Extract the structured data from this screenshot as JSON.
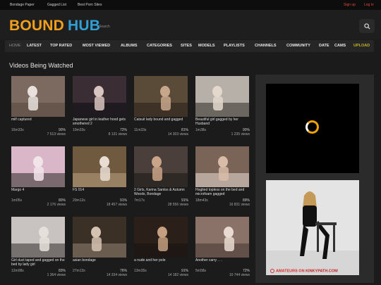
{
  "topbar": {
    "links": [
      "Bondage Paper",
      "Gagged List",
      "Best Porn Sites"
    ],
    "signup": "Sign up",
    "login": "Log in"
  },
  "logo": {
    "part1": "BOUND",
    "part2": "HUB"
  },
  "search": {
    "placeholder": "Search"
  },
  "nav": [
    "HOME",
    "LATEST",
    "TOP RATED",
    "MOST VIEWED",
    "ALBUMS",
    "CATEGORIES",
    "SITES",
    "MODELS",
    "PLAYLISTS",
    "CHANNELS",
    "COMMUNITY",
    "DATE",
    "CAMS",
    "UPLOAD"
  ],
  "section": {
    "title": "Videos Being Watched"
  },
  "videos": [
    {
      "title": "milf captured",
      "duration": "16m33s",
      "rating": "90%",
      "views": "7 513 views"
    },
    {
      "title": "Japanese girl in leather hood gets smothered 2",
      "duration": "10m33s",
      "rating": "72%",
      "views": "8 131 views"
    },
    {
      "title": "Catsuit lady bound and gagged",
      "duration": "11m33s",
      "rating": "81%",
      "views": "14 303 views"
    },
    {
      "title": "Beautiful girl gagged by her Husband",
      "duration": "1m38s",
      "rating": "90%",
      "views": "1 235 views"
    },
    {
      "title": "Margo 4",
      "duration": "1m05s",
      "rating": "80%",
      "views": "2 176 views"
    },
    {
      "title": "FS 014",
      "duration": "20m12s",
      "rating": "91%",
      "views": "18 457 views"
    },
    {
      "title": "2 Girls, Karina Santos & Autumn Woods, Bondage",
      "duration": "7m17s",
      "rating": "91%",
      "views": "28 556 views"
    },
    {
      "title": "Hogtied topless on the bed and microfoam gagged",
      "duration": "18m43s",
      "rating": "89%",
      "views": "16 831 views"
    },
    {
      "title": "Girl duct taped and gagged on the bed by lady girl",
      "duration": "12m08s",
      "rating": "83%",
      "views": "1 364 views"
    },
    {
      "title": "asian bondage",
      "duration": "27m13s",
      "rating": "76%",
      "views": "14 334 views"
    },
    {
      "title": "a nude and her pole",
      "duration": "13m35s",
      "rating": "91%",
      "views": "14 182 views"
    },
    {
      "title": "Another carry . . .",
      "duration": "5m58s",
      "rating": "72%",
      "views": "10 744 views"
    }
  ],
  "ad": {
    "prefix": "AMATEURS ON",
    "site": "KINKYPATH.COM"
  },
  "colors": {
    "accent_orange": "#f2a01b",
    "accent_blue": "#2f9fd6",
    "upload": "#c9b31f",
    "signup": "#e0463b"
  }
}
